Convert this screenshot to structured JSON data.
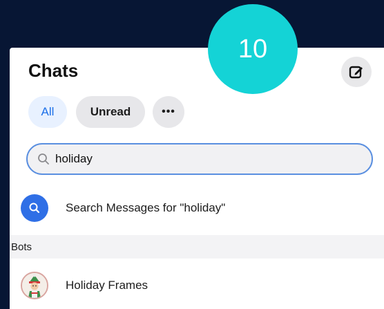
{
  "step_badge": "10",
  "header": {
    "title": "Chats",
    "compose_icon": "compose-icon"
  },
  "filters": {
    "all": "All",
    "unread": "Unread",
    "more": "•••"
  },
  "search": {
    "value": "holiday",
    "icon": "search-icon"
  },
  "results": {
    "search_messages_label": "Search Messages for \"holiday\"",
    "search_messages_icon": "search-icon",
    "bots_section_label": "Bots",
    "bot_name": "Holiday Frames",
    "bot_avatar_icon": "elf-avatar-icon"
  },
  "colors": {
    "background": "#071634",
    "badge": "#14d3d6",
    "accent_blue": "#2f6fe6",
    "filter_all_bg": "#e8f1ff",
    "filter_all_text": "#1b6fe8"
  }
}
